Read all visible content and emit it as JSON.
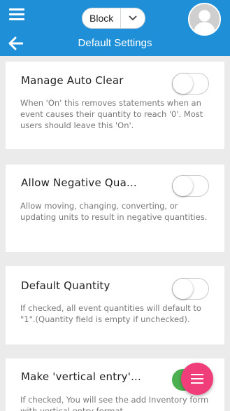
{
  "header": {
    "block_select": {
      "value": "Block"
    },
    "title": "Default Settings",
    "colors": {
      "bar": "#1f8fd8",
      "fab": "#f03e7b",
      "toggle_on": "#4caf50"
    }
  },
  "settings": [
    {
      "title": "Manage Auto Clear",
      "description": "When 'On' this removes statements when an event causes their quantity to reach '0'. Most users should leave this 'On'.",
      "toggle_on": false
    },
    {
      "title": "Allow Negative Qua...",
      "description": "Allow moving, changing, converting, or updating units to result in negative quantities.",
      "toggle_on": false
    },
    {
      "title": "Default Quantity",
      "description": "If checked, all event quantities will default to \"1\".(Quantity field is empty if unchecked).",
      "toggle_on": false
    },
    {
      "title": "Make 'vertical entry'...",
      "description": "If checked, You will see the add Inventory form with vertical entry format.",
      "toggle_on": true
    }
  ],
  "icons": {
    "menu": "hamburger-icon",
    "dropdown": "chevron-down-icon",
    "avatar": "user-avatar-icon",
    "back": "back-arrow-icon",
    "fab": "menu-fab-icon"
  }
}
